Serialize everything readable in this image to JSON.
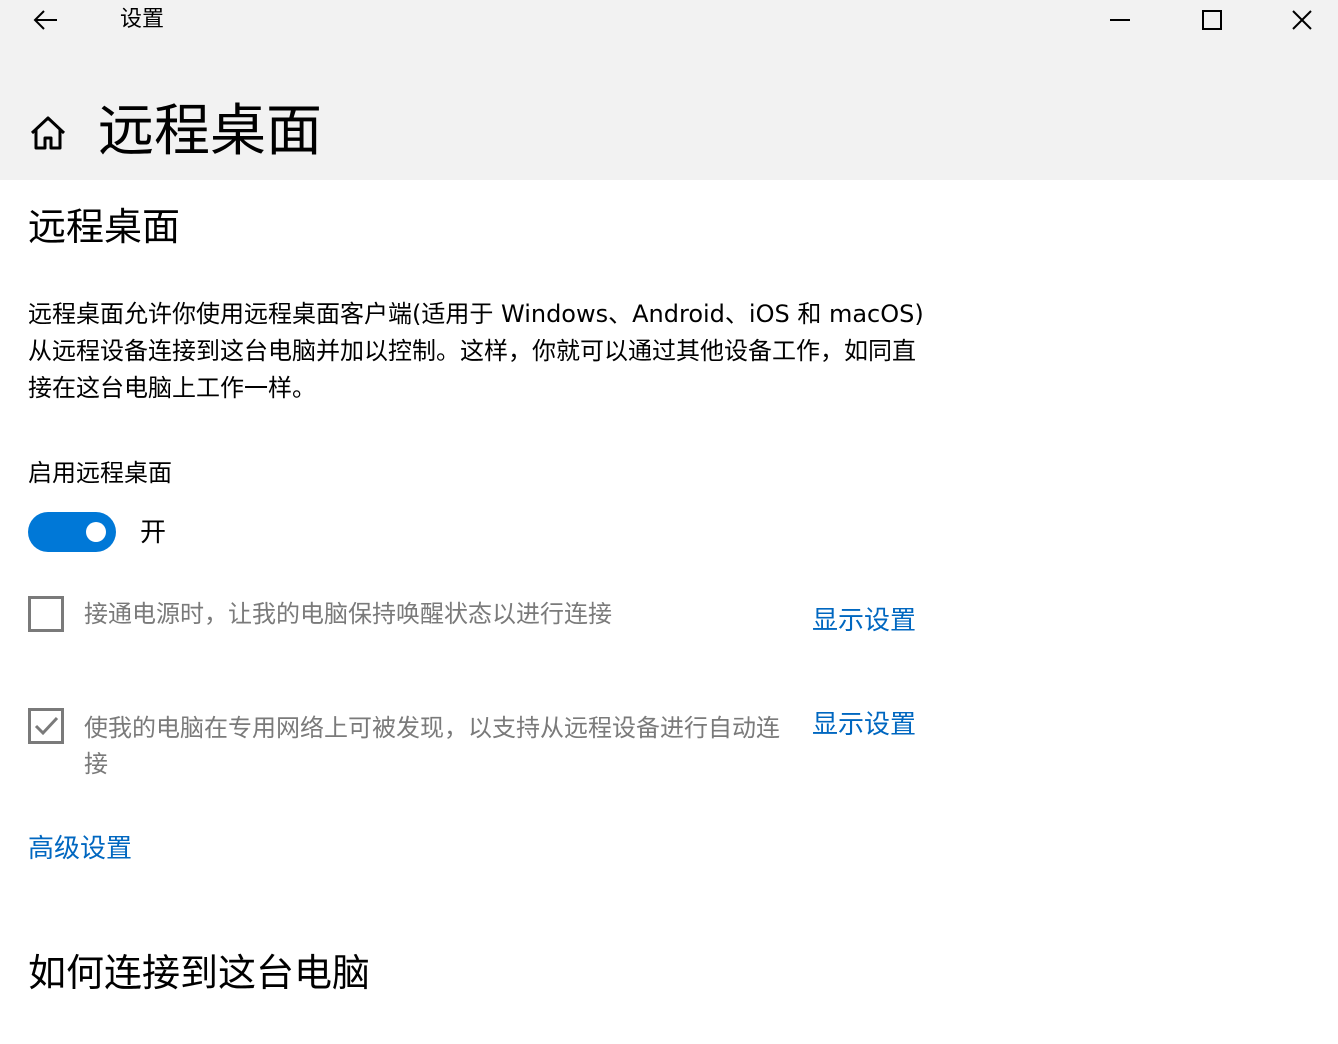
{
  "window": {
    "app_title": "设置"
  },
  "header": {
    "page_title": "远程桌面"
  },
  "section_remote": {
    "title": "远程桌面",
    "description": "远程桌面允许你使用远程桌面客户端(适用于 Windows、Android、iOS 和 macOS)从远程设备连接到这台电脑并加以控制。这样，你就可以通过其他设备工作，如同直接在这台电脑上工作一样。",
    "toggle_label": "启用远程桌面",
    "toggle_state": "开",
    "toggle_on": true
  },
  "options": [
    {
      "text": "接通电源时，让我的电脑保持唤醒状态以进行连接",
      "checked": false,
      "link": "显示设置"
    },
    {
      "text": "使我的电脑在专用网络上可被发现，以支持从远程设备进行自动连接",
      "checked": true,
      "link": "显示设置"
    }
  ],
  "advanced_link": "高级设置",
  "section_connect": {
    "title": "如何连接到这台电脑"
  },
  "colors": {
    "accent": "#0078d7",
    "link": "#0067c0",
    "disabled_text": "#7a7a7a",
    "header_bg": "#f2f2f2"
  },
  "icons": {
    "back": "arrow-left-icon",
    "minimize": "minimize-icon",
    "maximize": "maximize-icon",
    "close": "close-icon",
    "home": "home-icon"
  }
}
